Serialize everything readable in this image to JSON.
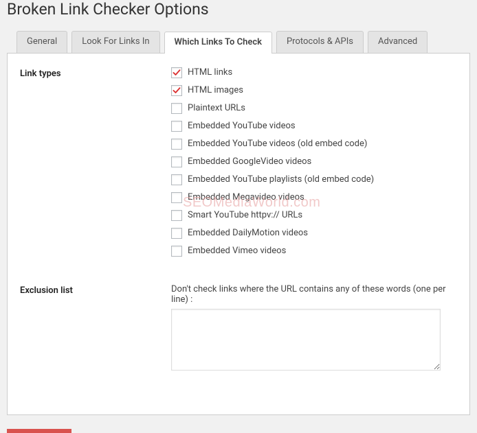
{
  "page_title": "Broken Link Checker Options",
  "tabs": [
    {
      "label": "General"
    },
    {
      "label": "Look For Links In"
    },
    {
      "label": "Which Links To Check"
    },
    {
      "label": "Protocols & APIs"
    },
    {
      "label": "Advanced"
    }
  ],
  "active_tab_index": 2,
  "sections": {
    "link_types": {
      "label": "Link types",
      "items": [
        {
          "label": "HTML links",
          "checked": true
        },
        {
          "label": "HTML images",
          "checked": true
        },
        {
          "label": "Plaintext URLs",
          "checked": false
        },
        {
          "label": "Embedded YouTube videos",
          "checked": false
        },
        {
          "label": "Embedded YouTube videos (old embed code)",
          "checked": false
        },
        {
          "label": "Embedded GoogleVideo videos",
          "checked": false
        },
        {
          "label": "Embedded YouTube playlists (old embed code)",
          "checked": false
        },
        {
          "label": "Embedded Megavideo videos",
          "checked": false
        },
        {
          "label": "Smart YouTube httpv:// URLs",
          "checked": false
        },
        {
          "label": "Embedded DailyMotion videos",
          "checked": false
        },
        {
          "label": "Embedded Vimeo videos",
          "checked": false
        }
      ]
    },
    "exclusion_list": {
      "label": "Exclusion list",
      "description": "Don't check links where the URL contains any of these words (one per line) :",
      "value": ""
    }
  },
  "watermark": "SEOMediaWorld.com",
  "colors": {
    "accent_red": "#d9534f",
    "check_red": "#dc3232"
  }
}
